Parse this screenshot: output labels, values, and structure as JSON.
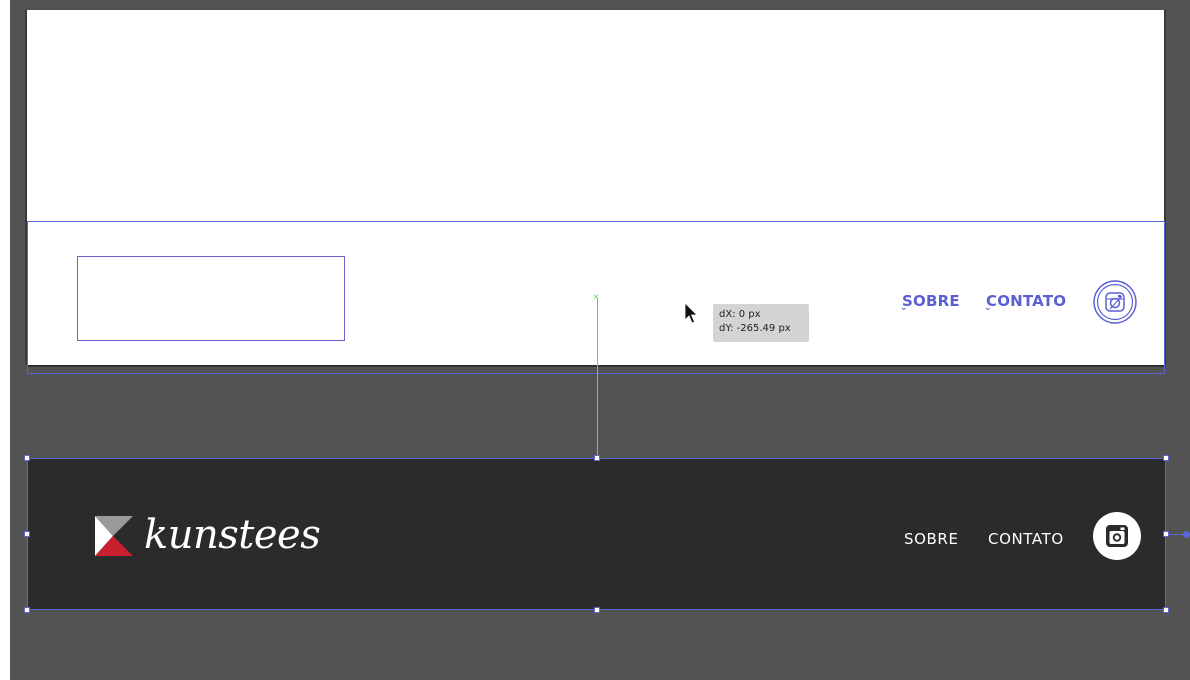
{
  "measure_tooltip": {
    "dx": "dX: 0 px",
    "dy": "dY: -265.49 px"
  },
  "wireframe_header": {
    "nav": [
      "SOBRE",
      "CONTATO"
    ],
    "instagram_icon": "instagram-icon"
  },
  "footer": {
    "brand": "kunstees",
    "nav": [
      "SOBRE",
      "CONTATO"
    ],
    "instagram_icon": "instagram-icon"
  },
  "colors": {
    "canvas": "#535353",
    "artboard": "#ffffff",
    "selection": "#5b66d6",
    "guide": "#5ad45a",
    "footer_bg": "#2b2b2b",
    "brand_red": "#c8202f"
  }
}
